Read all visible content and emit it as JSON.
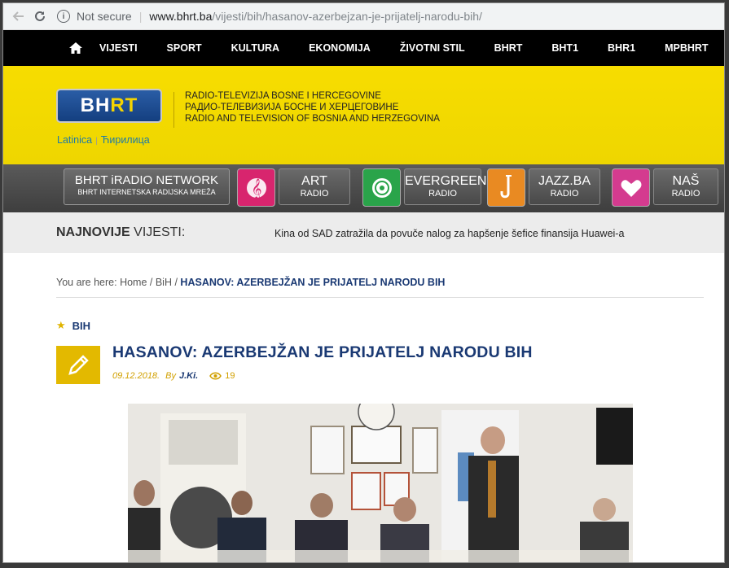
{
  "browser": {
    "security": "Not secure",
    "url_host": "www.bhrt.ba",
    "url_path": "/vijesti/bih/hasanov-azerbejzan-je-prijatelj-narodu-bih/"
  },
  "nav": {
    "items": [
      "VIJESTI",
      "SPORT",
      "KULTURA",
      "EKONOMIJA",
      "ŽIVOTNI STIL",
      "BHRT",
      "BHT1",
      "BHR1",
      "MPBHRT"
    ]
  },
  "header": {
    "logo_bh": "BH",
    "logo_rt": "RT",
    "org_lines": [
      "RADIO-TELEVIZIJA BOSNE I HERCEGOVINE",
      "РАДИО-ТЕЛЕВИЗИЈА БОСНЕ И ХЕРЦЕГОВИНЕ",
      "RADIO AND TELEVISION OF BOSNIA  AND HERZEGOVINA"
    ],
    "latin": "Latinica",
    "separator": "|",
    "cyrillic": "Ћирилица"
  },
  "radio": {
    "network_title": "BHRT iRADIO NETWORK",
    "network_sub": "BHRT INTERNETSKA RADIJSKA MREŽA",
    "stations": [
      {
        "name": "ART",
        "sub": "RADIO",
        "color": "#d8256e",
        "icon": "treble-clef-icon"
      },
      {
        "name": "EVERGREEN",
        "sub": "RADIO",
        "color": "#2aa44a",
        "icon": "vinyl-record-icon"
      },
      {
        "name": "JAZZ.BA",
        "sub": "RADIO",
        "color": "#e98a22",
        "icon": "saxophone-icon"
      },
      {
        "name": "NAŠ",
        "sub": "RADIO",
        "color": "#d43b8f",
        "icon": "heart-icon"
      }
    ]
  },
  "ticker": {
    "label_bold": "NAJNOVIJE",
    "label_rest": " VIJESTI:",
    "headline": "Kina od SAD zatražila da povuče nalog za hapšenje šefice finansija Huawei-a"
  },
  "breadcrumb": {
    "prefix": "You are here: ",
    "home": "Home",
    "sep": " / ",
    "section": "BiH",
    "current": "HASANOV: AZERBEJŽAN JE PRIJATELJ NARODU BIH"
  },
  "article": {
    "category": "BIH",
    "title": "HASANOV: AZERBEJŽAN JE PRIJATELJ NARODU BIH",
    "date": "09.12.2018.",
    "by": "By",
    "author": "J.Ki.",
    "views": "19"
  },
  "colors": {
    "yellow": "#f3d900",
    "navy": "#1a3973",
    "gold": "#e3b900"
  }
}
